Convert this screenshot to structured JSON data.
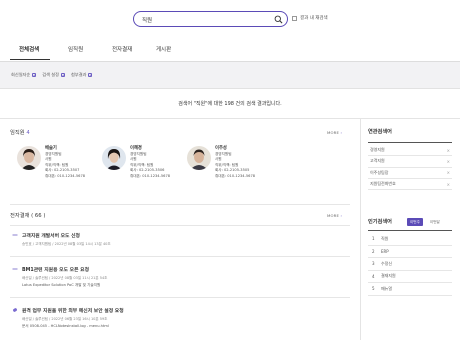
{
  "search": {
    "value": "직원",
    "within_label": "결과 내 재검색"
  },
  "tabs": [
    {
      "label": "전체검색"
    },
    {
      "label": "임직원"
    },
    {
      "label": "전자결재"
    },
    {
      "label": "게시판"
    }
  ],
  "filters": [
    {
      "label": "회신일자순"
    },
    {
      "label": "검색 설정"
    },
    {
      "label": "첨부결과"
    }
  ],
  "result_message": "검색어 \"직원\"에 대한 198 건의 검색 결과입니다.",
  "employees": {
    "title": "임직원",
    "count": "4",
    "more_label": "MORE",
    "people": [
      {
        "name": "배슬기",
        "line1": "경영지원팀",
        "line2": "사원",
        "line3": "직위/직책: 팀원",
        "line4": "회사: 02-2105-3507",
        "line5": "휴대폰: 010-1234-5678"
      },
      {
        "name": "이혜경",
        "line1": "경영지원팀",
        "line2": "사원",
        "line3": "직위/직책: 팀원",
        "line4": "회사: 02-2105-3506",
        "line5": "휴대폰: 010-1234-5678"
      },
      {
        "name": "이주성",
        "line1": "경영지원팀",
        "line2": "사원",
        "line3": "직위/직책: 팀원",
        "line4": "회사: 02-2105-3505",
        "line5": "휴대폰: 010-1234-5678"
      }
    ]
  },
  "approval": {
    "title": "전자결재 ( 66 )",
    "more_label": "MORE",
    "docs": [
      {
        "title": "고객지원 개발서버 오도 신청",
        "meta": "송민호 / 고객지원팀 / 2022년 08월 03일 14시 13분 40초",
        "body": ""
      },
      {
        "title": "BM1관련 지원용 오도 오픈 요청",
        "meta": "배산일 / 솔루션팀 / 2022년 08월 03일 11시 21분 54초",
        "body": "Lotus Expeditor Solution PoC 개발 및 기술지원"
      },
      {
        "title": "원격 업무 지원을 위한 외부 메신저 보안 설정 요청",
        "meta": "배산일 / 솔루션팀 / 2022년 06월 23일 16시 10분 59초",
        "body": "문서 0508-045 - HCLNotesInstall.log - menu.html"
      }
    ]
  },
  "related": {
    "title": "연관검색어",
    "items": [
      {
        "label": "경영지원"
      },
      {
        "label": "고객지원"
      },
      {
        "label": "이주성팀장"
      },
      {
        "label": "지원팀전화번호"
      }
    ]
  },
  "popular": {
    "title": "인기검색어",
    "tabs": [
      {
        "label": "이번주"
      },
      {
        "label": "이번달"
      }
    ],
    "items": [
      {
        "rank": "1",
        "label": "직원"
      },
      {
        "rank": "2",
        "label": "ERP"
      },
      {
        "rank": "3",
        "label": "수정신"
      },
      {
        "rank": "4",
        "label": "결재지원"
      },
      {
        "rank": "5",
        "label": "매뉴얼"
      }
    ]
  },
  "colors": {
    "accent": "#5b4bb7"
  }
}
